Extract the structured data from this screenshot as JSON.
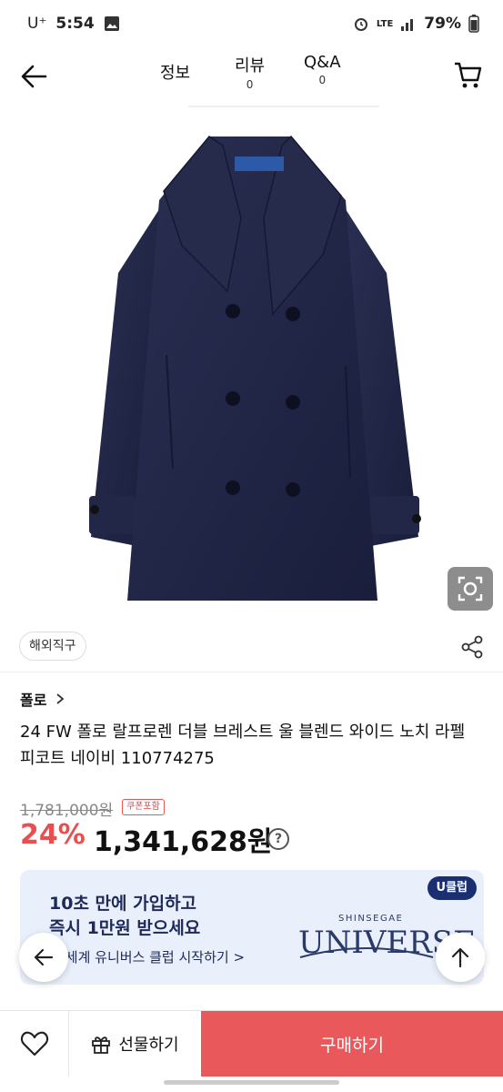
{
  "status_bar": {
    "carrier": "U⁺",
    "time": "5:54",
    "network": "LTE",
    "battery": "79%"
  },
  "nav": {
    "tabs": [
      {
        "label": "정보"
      },
      {
        "label": "리뷰",
        "count": "0"
      },
      {
        "label": "Q&A",
        "count": "0"
      }
    ]
  },
  "product": {
    "badge": "해외직구",
    "brand": "폴로",
    "title": "24 FW 폴로 랄프로렌 더블 브레스트 울 블렌드 와이드 노치 라펠 피코트 네이비 110774275",
    "original_price": "1,781,000원",
    "coupon_badge": "쿠폰포함",
    "discount": "24%",
    "price": "1,341,628원",
    "image_icon": "navy-peacoat-image"
  },
  "banner": {
    "line1": "10초 만에 가입하고",
    "line2": "즉시 1만원 받으세요",
    "cta": "신세계 유니버스 클럽 시작하기 >",
    "badge": "U클럽",
    "logo_top": "SHINSEGAE",
    "logo_main": "UNIVERSE"
  },
  "bottom_bar": {
    "gift_label": "선물하기",
    "buy_label": "구매하기"
  },
  "colors": {
    "accent": "#e9585a",
    "discount": "#e94f4f",
    "banner_bg": "#eaf0fb",
    "navy": "#1a2f72"
  }
}
